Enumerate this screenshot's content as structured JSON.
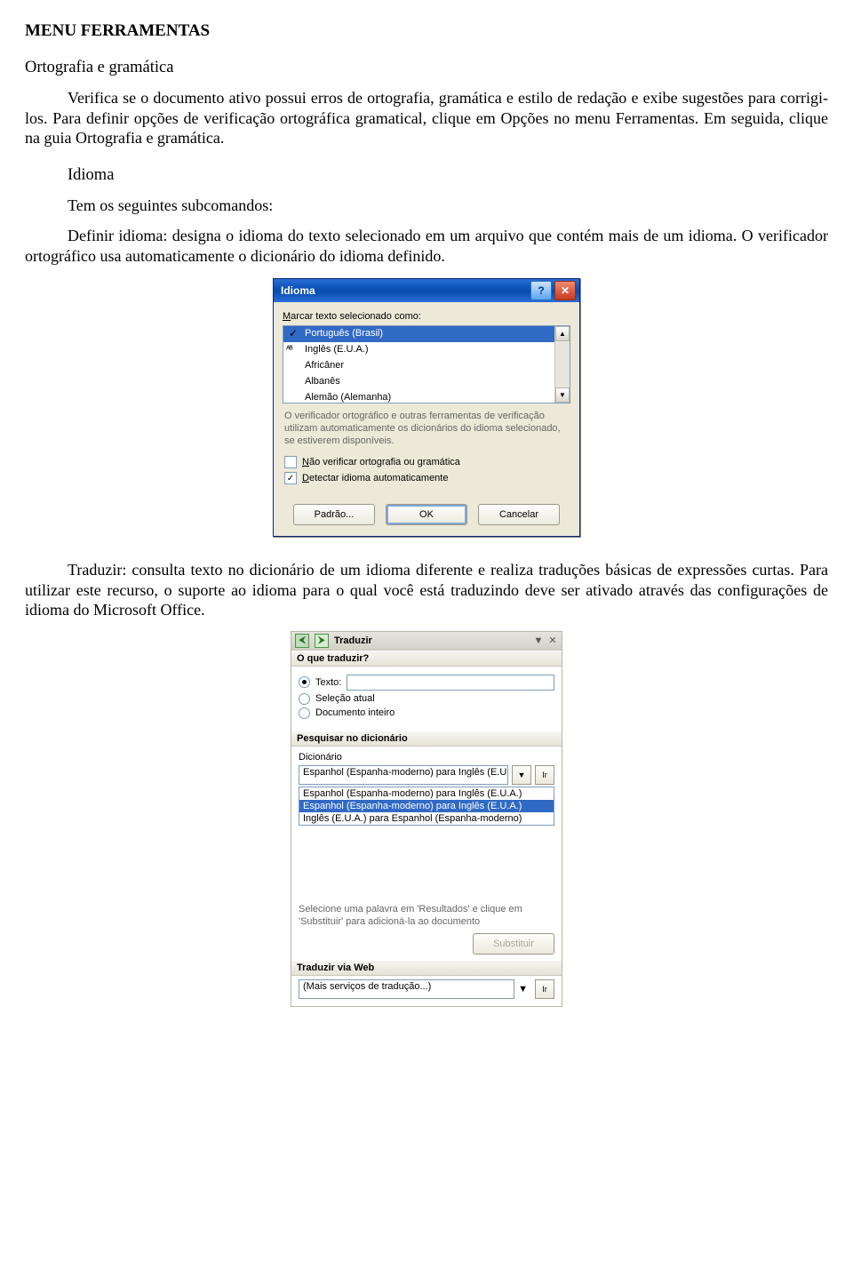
{
  "doc": {
    "title": "MENU FERRAMENTAS",
    "section1_heading": "Ortografia e gramática",
    "para1": "Verifica se o documento ativo possui erros de ortografia, gramática e estilo de redação e exibe sugestões para corrigi-los. Para definir opções de verificação ortográfica gramatical, clique em Opções no menu Ferramentas. Em seguida, clique na guia Ortografia e gramática.",
    "idioma_heading": "Idioma",
    "idioma_sub": "Tem os seguintes subcomandos:",
    "para2": "Definir idioma: designa o idioma do texto selecionado em um arquivo que contém mais de um idioma. O verificador ortográfico usa automaticamente o dicionário do idioma definido.",
    "para3": "Traduzir: consulta texto no dicionário de um idioma diferente e realiza traduções básicas de expressões curtas. Para utilizar este recurso, o suporte ao idioma para o qual você está traduzindo deve ser ativado através das configurações de idioma do Microsoft Office."
  },
  "dlg": {
    "title": "Idioma",
    "label_mark": "Marcar texto selecionado como:",
    "languages": {
      "sel": "Português (Brasil)",
      "ingles": "Inglês (E.U.A.)",
      "africaner": "Africâner",
      "albanes": "Albanês",
      "alemao": "Alemão (Alemanha)"
    },
    "help_text": "O verificador ortográfico e outras ferramentas de verificação utilizam automaticamente os dicionários do idioma selecionado, se estiverem disponíveis.",
    "chk_noverify": "Não verificar ortografia ou gramática",
    "chk_detect": "Detectar idioma automaticamente",
    "btn_default": "Padrão...",
    "btn_ok": "OK",
    "btn_cancel": "Cancelar"
  },
  "pane": {
    "title": "Traduzir",
    "section_what": "O que traduzir?",
    "radio_text": "Texto:",
    "radio_selection": "Seleção atual",
    "radio_document": "Documento inteiro",
    "section_dict": "Pesquisar no dicionário",
    "label_dict": "Dicionário",
    "combo_value": "Espanhol (Espanha-moderno) para Inglês (E.U.A.)",
    "go": "Ir",
    "dict1": "Espanhol (Espanha-moderno) para Inglês (E.U.A.)",
    "dict2": "Espanhol (Espanha-moderno) para Inglês (E.U.A.)",
    "dict3": "Inglês (E.U.A.) para Espanhol (Espanha-moderno)",
    "hint": "Selecione uma palavra em 'Resultados' e clique em 'Substituir' para adicioná-la ao documento",
    "btn_replace": "Substituir",
    "section_web": "Traduzir via Web",
    "web_value": "(Mais serviços de tradução...)",
    "web_go": "Ir"
  }
}
